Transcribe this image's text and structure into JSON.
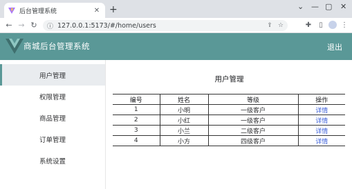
{
  "browser": {
    "tab_title": "后台管理系统",
    "url": "127.0.0.1:5173/#/home/users",
    "new_tab": "+",
    "tab_close": "✕",
    "window_controls": [
      "⌄",
      "—",
      "▢",
      "✕"
    ]
  },
  "toolbar_icons": [
    "share-icon",
    "star-icon",
    "puzzle-icon",
    "sidepanel-icon",
    "profile-avatar",
    "menu-kebab-icon"
  ],
  "header": {
    "app_title": "商城后台管理系统",
    "logout_label": "退出",
    "background_color": "#5a9897"
  },
  "sidebar": {
    "items": [
      {
        "label": "用户管理",
        "active": true
      },
      {
        "label": "权限管理",
        "active": false
      },
      {
        "label": "商品管理",
        "active": false
      },
      {
        "label": "订单管理",
        "active": false
      },
      {
        "label": "系统设置",
        "active": false
      }
    ]
  },
  "main": {
    "heading": "用户管理",
    "table": {
      "headers": [
        "编号",
        "姓名",
        "等级",
        "操作"
      ],
      "rows": [
        [
          "1",
          "小明",
          "一级客户",
          "详情"
        ],
        [
          "2",
          "小红",
          "一级客户",
          "详情"
        ],
        [
          "3",
          "小兰",
          "二级客户",
          "详情"
        ],
        [
          "4",
          "小方",
          "四级客户",
          "详情"
        ]
      ]
    }
  },
  "colors": {
    "accent": "#5a9897",
    "link": "#3b5fd9"
  }
}
